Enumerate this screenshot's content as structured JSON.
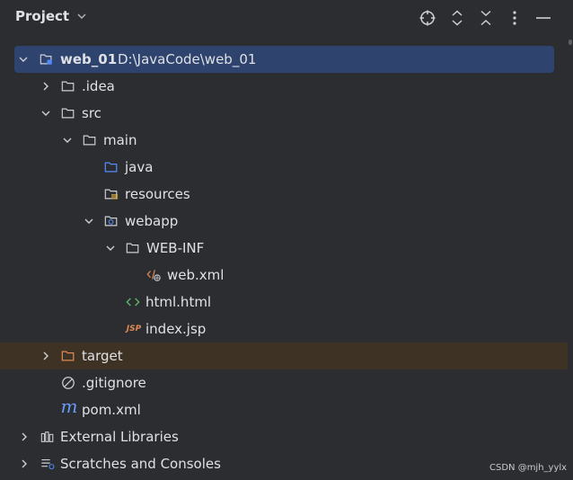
{
  "header": {
    "title": "Project",
    "tools": [
      "locate-icon",
      "expand-all-icon",
      "collapse-all-icon",
      "more-options-icon",
      "hide-icon"
    ]
  },
  "tree": {
    "root": {
      "name": "web_01",
      "path": "D:\\JavaCode\\web_01"
    },
    "idea": ".idea",
    "src": "src",
    "main": "main",
    "java": "java",
    "resources": "resources",
    "webapp": "webapp",
    "webinf": "WEB-INF",
    "webxml": "web.xml",
    "htmlhtml": "html.html",
    "indexjsp": "index.jsp",
    "jsp_badge": "JSP",
    "target": "target",
    "gitignore": ".gitignore",
    "pom": "pom.xml",
    "pom_badge": "m",
    "external": "External Libraries",
    "scratches": "Scratches and Consoles"
  },
  "colors": {
    "background": "#2b2d30",
    "selection": "#2e436e",
    "excluded_row": "#3d3223",
    "text": "#dfe1e5",
    "source_folder": "#548af7",
    "excluded_folder": "#e08855",
    "html_icon": "#5fb865",
    "maven_icon": "#6b9bfa"
  },
  "watermark": "CSDN @mjh_yylx"
}
